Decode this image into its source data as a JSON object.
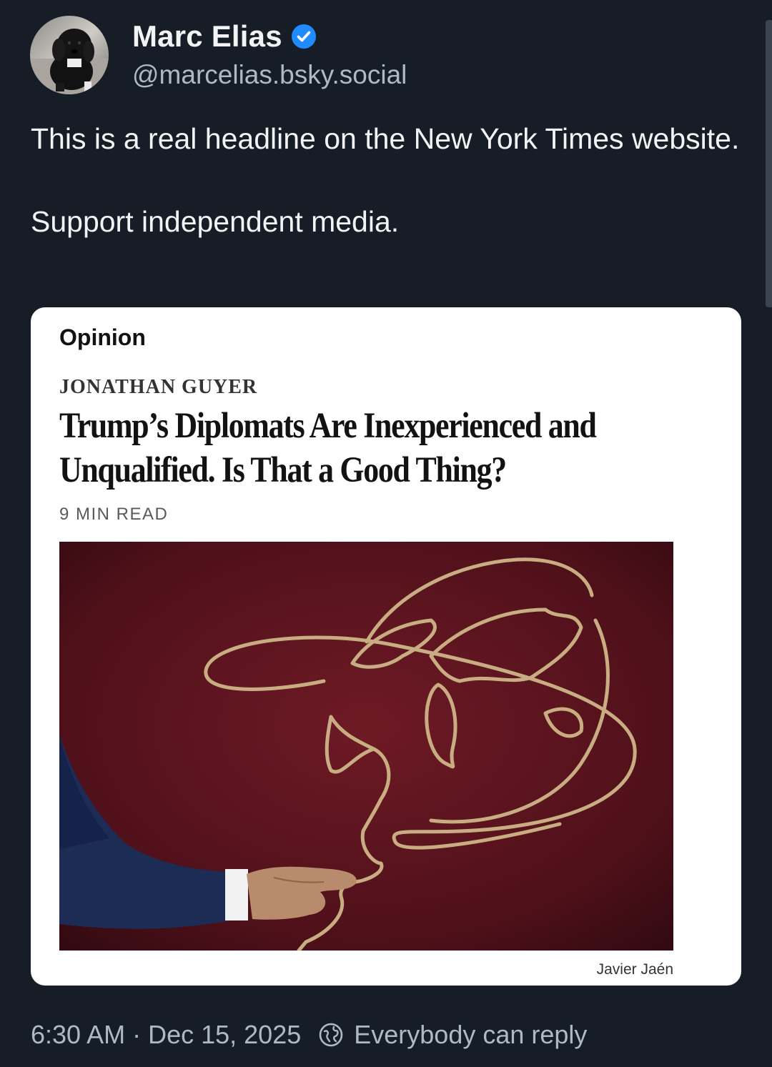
{
  "author": {
    "display_name": "Marc Elias",
    "handle": "@marcelias.bsky.social",
    "verified": true,
    "avatar_icon": "dog-avatar",
    "verified_icon": "verified-check-icon"
  },
  "post": {
    "paragraph_1": "This is a real headline on the New York Times website.",
    "paragraph_2": "Support independent media."
  },
  "embed": {
    "section": "Opinion",
    "byline": "JONATHAN GUYER",
    "headline": "Trump’s Diplomats Are Inexperienced and Unqualified. Is That a Good Thing?",
    "read_time": "9 MIN READ",
    "image_description_icon": "hand-lasso-globe-illustration",
    "image_credit": "Javier Jaén"
  },
  "meta": {
    "time": "6:30 AM",
    "separator": "·",
    "date": "Dec 15, 2025",
    "reply_setting": "Everybody can reply",
    "reply_icon": "globe-icon"
  },
  "colors": {
    "background": "#171d26",
    "text_primary": "#f1f3f5",
    "text_secondary": "#aeb9c6",
    "verified_blue": "#208bfe",
    "image_background": "#5e1620"
  }
}
